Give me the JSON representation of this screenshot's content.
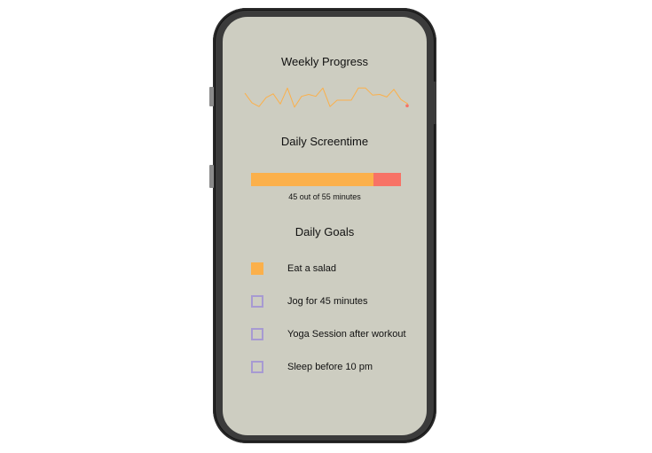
{
  "weekly_progress": {
    "title": "Weekly Progress",
    "line_color": "#fbb04b",
    "endpoint_color": "#f77266",
    "values": [
      0.72,
      0.42,
      0.3,
      0.58,
      0.7,
      0.38,
      0.88,
      0.28,
      0.62,
      0.68,
      0.62,
      0.88,
      0.3,
      0.5,
      0.5,
      0.5,
      0.88,
      0.88,
      0.66,
      0.68,
      0.6,
      0.84,
      0.52,
      0.38
    ]
  },
  "daily_screentime": {
    "title": "Daily Screentime",
    "used_minutes": 45,
    "limit_minutes": 55,
    "caption": "45 out of 55 minutes",
    "used_color": "#fbb04b",
    "remaining_color": "#f77266"
  },
  "daily_goals": {
    "title": "Daily Goals",
    "items": [
      {
        "label": "Eat a salad",
        "checked": true
      },
      {
        "label": "Jog for 45 minutes",
        "checked": false
      },
      {
        "label": "Yoga Session after workout",
        "checked": false
      },
      {
        "label": "Sleep before 10 pm",
        "checked": false
      }
    ],
    "checked_color": "#fbb04b",
    "unchecked_color": "#a79ad2"
  }
}
